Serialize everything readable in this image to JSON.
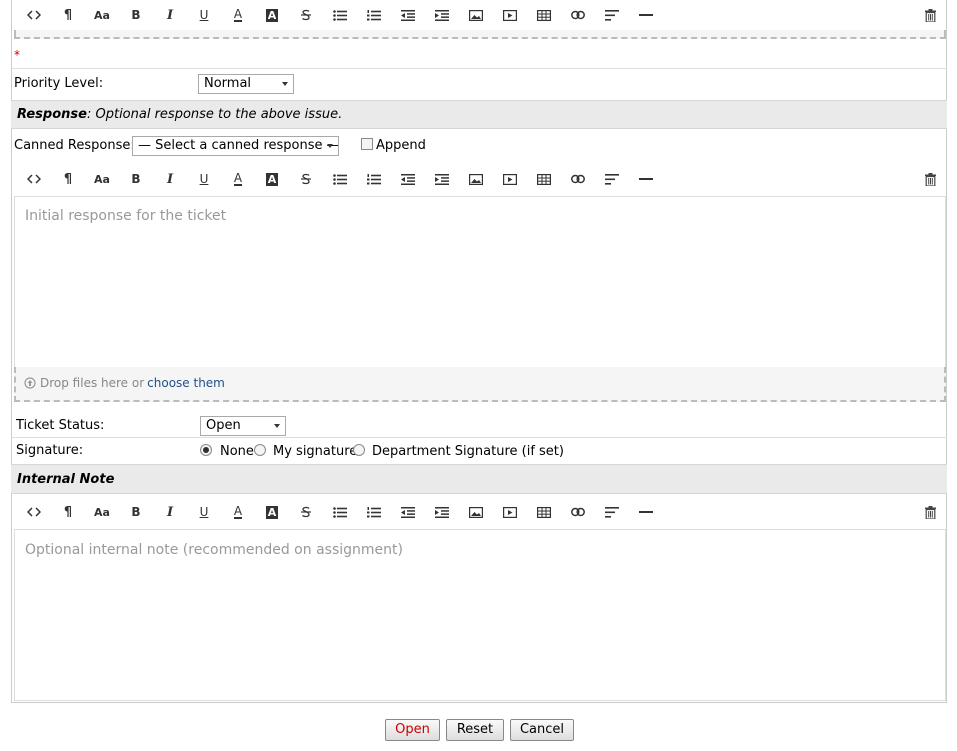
{
  "toolbar_buttons": [
    "code-icon",
    "paragraph-icon",
    "font-size-icon",
    "bold-icon",
    "italic-icon",
    "underline-icon",
    "font-color-icon",
    "highlight-icon",
    "strikethrough-icon",
    "bullet-list-icon",
    "numbered-list-icon",
    "outdent-icon",
    "indent-icon",
    "image-icon",
    "video-icon",
    "table-icon",
    "link-icon",
    "align-icon",
    "horizontal-rule-icon"
  ],
  "toolbar_glyphs": {
    "paragraph": "¶",
    "font_size": "Aa",
    "bold": "B",
    "italic": "I",
    "underline": "U",
    "font_color": "A",
    "highlight": "A"
  },
  "required_mark": "*",
  "priority": {
    "label": "Priority Level:",
    "value": "Normal"
  },
  "response": {
    "heading_bold": "Response",
    "heading_text": ": Optional response to the above issue.",
    "canned_label": "Canned Response:",
    "canned_value": "— Select a canned response —",
    "append_label": "Append",
    "placeholder": "Initial response for the ticket",
    "drop_text": "Drop files here or ",
    "drop_link": "choose them"
  },
  "ticket_status": {
    "label": "Ticket Status:",
    "value": "Open"
  },
  "signature": {
    "label": "Signature:",
    "options": [
      "None",
      "My signature",
      "Department Signature (if set)"
    ],
    "selected": "None"
  },
  "internal_note": {
    "heading": "Internal Note",
    "placeholder": "Optional internal note (recommended on assignment)"
  },
  "buttons": {
    "open": "Open",
    "reset": "Reset",
    "cancel": "Cancel"
  },
  "colors": {
    "open_text": "#cc0000",
    "link": "#1f4f8a",
    "required": "#cc0000"
  }
}
